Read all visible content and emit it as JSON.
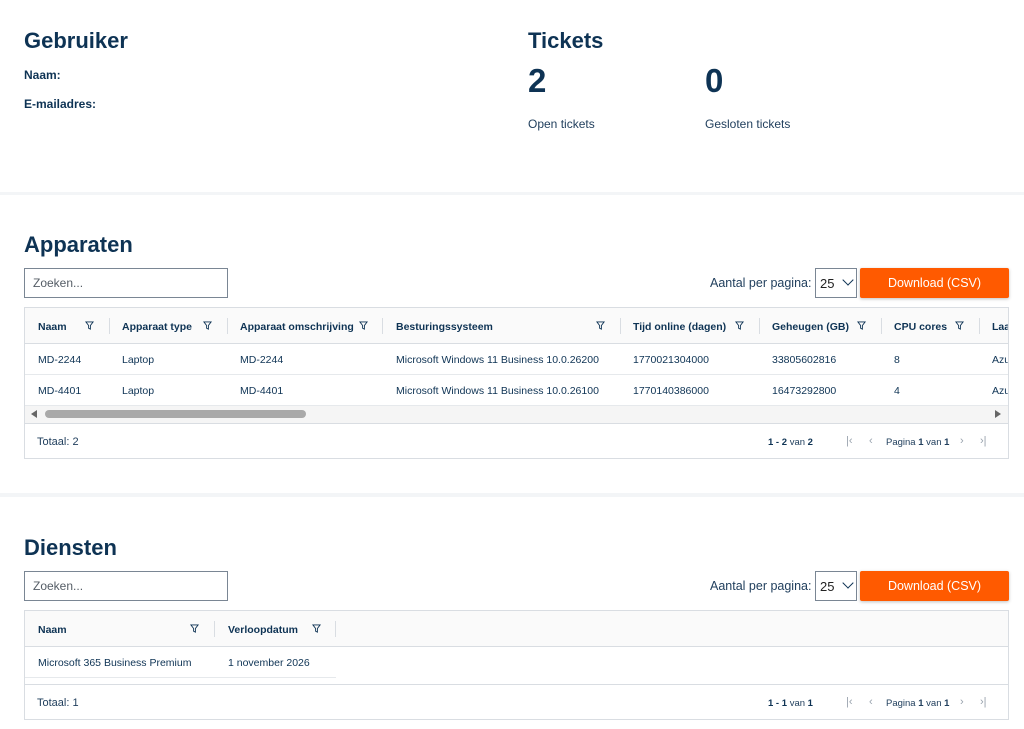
{
  "user": {
    "title": "Gebruiker",
    "name_label": "Naam:",
    "email_label": "E-mailadres:"
  },
  "tickets": {
    "title": "Tickets",
    "open_count": "2",
    "open_label": "Open tickets",
    "closed_count": "0",
    "closed_label": "Gesloten tickets"
  },
  "devices": {
    "title": "Apparaten",
    "search_placeholder": "Zoeken...",
    "per_page_label": "Aantal per pagina:",
    "per_page_value": "25",
    "download_label": "Download (CSV)",
    "columns": [
      "Naam",
      "Apparaat type",
      "Apparaat omschrijving",
      "Besturingssysteem",
      "Tijd online (dagen)",
      "Geheugen (GB)",
      "CPU cores",
      "Laa"
    ],
    "rows": [
      [
        "MD-2244",
        "Laptop",
        "MD-2244",
        "Microsoft Windows 11 Business 10.0.26200",
        "1770021304000",
        "33805602816",
        "8",
        "Azu"
      ],
      [
        "MD-4401",
        "Laptop",
        "MD-4401",
        "Microsoft Windows 11 Business 10.0.26100",
        "1770140386000",
        "16473292800",
        "4",
        "Azu"
      ]
    ],
    "total": "Totaal: 2",
    "range_from": "1",
    "range_sep": " - ",
    "range_to": "2",
    "range_of": "van",
    "range_total": "2",
    "page_label": "Pagina",
    "page_current": "1",
    "page_of": "van",
    "page_total": "1"
  },
  "services": {
    "title": "Diensten",
    "search_placeholder": "Zoeken...",
    "per_page_label": "Aantal per pagina:",
    "per_page_value": "25",
    "download_label": "Download (CSV)",
    "columns": [
      "Naam",
      "Verloopdatum"
    ],
    "rows": [
      [
        "Microsoft 365 Business Premium",
        "1 november 2026"
      ]
    ],
    "total": "Totaal: 1",
    "range_from": "1",
    "range_sep": " - ",
    "range_to": "1",
    "range_of": "van",
    "range_total": "1",
    "page_label": "Pagina",
    "page_current": "1",
    "page_of": "van",
    "page_total": "1"
  },
  "icons": {
    "filter": "filter-icon",
    "first": "⏮",
    "prev": "‹",
    "next": "›",
    "last": "⏭"
  },
  "colors": {
    "accent": "#ff5a00",
    "text": "#0e3354"
  }
}
